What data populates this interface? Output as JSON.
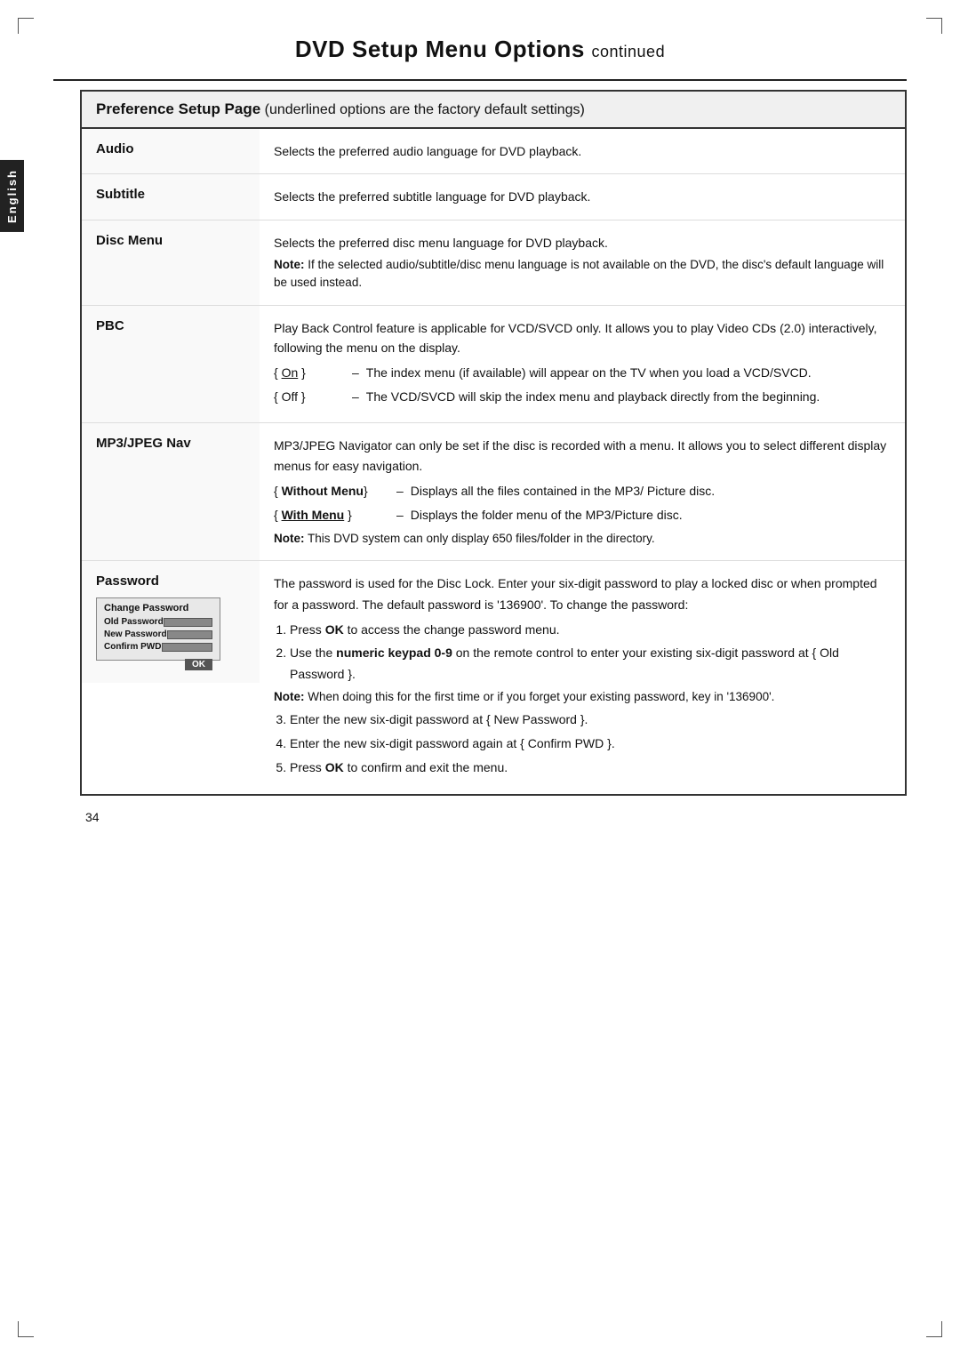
{
  "page": {
    "title": "DVD Setup Menu Options",
    "title_continued": "continued",
    "page_number": "34"
  },
  "sidebar": {
    "label": "English"
  },
  "pref_header": {
    "bold": "Preference Setup Page",
    "normal": "(underlined options are the factory default settings)"
  },
  "settings": [
    {
      "label": "Audio",
      "description": "Selects the preferred audio language for DVD playback."
    },
    {
      "label": "Subtitle",
      "description": "Selects the preferred subtitle language for DVD playback."
    },
    {
      "label": "Disc Menu",
      "description": "Selects the preferred disc menu language for DVD playback.",
      "note": "Note:  If the selected audio/subtitle/disc menu language is not available on the DVD, the disc's default language will be used instead."
    },
    {
      "label": "PBC",
      "description": "Play Back Control feature is applicable for VCD/SVCD only.  It allows you to play Video CDs (2.0) interactively, following the menu on the display.",
      "options": [
        {
          "key": "{ On }",
          "underline": true,
          "dash": "–",
          "value": "The index menu (if available) will appear on the TV when you load a VCD/SVCD."
        },
        {
          "key": "{ Off }",
          "underline": false,
          "dash": "–",
          "value": "The VCD/SVCD will skip the index menu and playback directly from the beginning."
        }
      ]
    },
    {
      "label": "MP3/JPEG Nav",
      "description": "MP3/JPEG Navigator can only be set if the disc is recorded with a menu.  It allows you to select different display menus for easy navigation.",
      "options": [
        {
          "key": "{ Without Menu}",
          "bold_key": true,
          "dash": "–",
          "value": "Displays all the files contained in the MP3/ Picture disc."
        },
        {
          "key": "{ With Menu }",
          "bold_key": true,
          "underline": true,
          "dash": "–",
          "value": "Displays the folder menu of the MP3/Picture disc."
        }
      ],
      "note": "Note:  This DVD system can only display 650 files/folder in the directory."
    }
  ],
  "password": {
    "label": "Password",
    "description": "The password is used for the Disc Lock.  Enter your six-digit password to play a locked disc or when prompted for a password.  The default password is '136900'.  To change the password:",
    "change_pwd_box": {
      "title": "Change Password",
      "fields": [
        {
          "label": "Old Password"
        },
        {
          "label": "New Password"
        },
        {
          "label": "Confirm PWD"
        }
      ],
      "ok_button": "OK"
    },
    "steps": [
      "Press <strong>OK</strong> to access the change password menu.",
      "Use the <strong>numeric keypad 0-9</strong> on the remote control to enter your existing six-digit password at { Old Password }.",
      "Enter the new six-digit password at { New Password }.",
      "Enter the new six-digit password again at { Confirm PWD }.",
      "Press <strong>OK</strong> to confirm and exit the menu."
    ],
    "note": "Note:  When doing this for the first time or if you forget your existing password, key in '136900'."
  }
}
